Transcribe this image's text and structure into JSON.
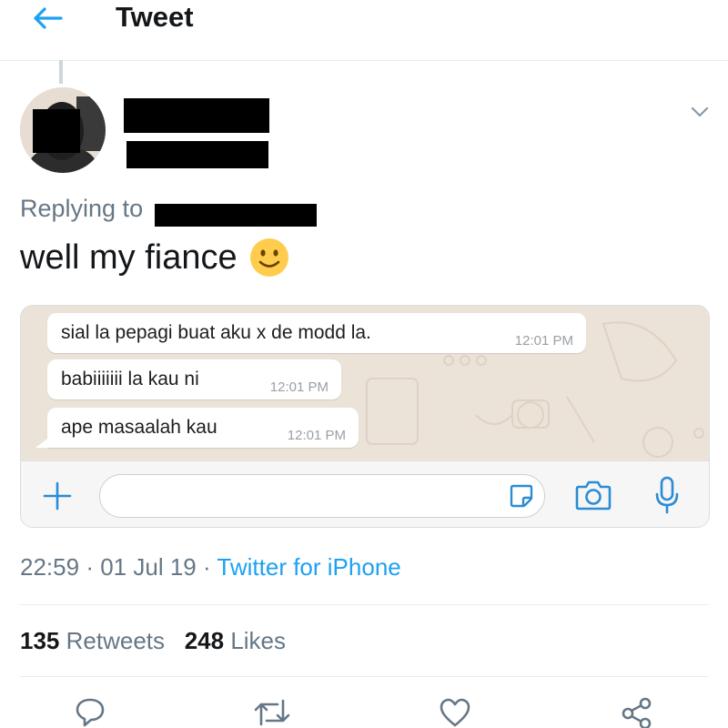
{
  "header": {
    "title": "Tweet",
    "back_icon": "back-arrow-icon"
  },
  "tweet": {
    "replying_label": "Replying to",
    "text": "well my fiance",
    "emoji": "🙂"
  },
  "whatsapp": {
    "messages": [
      {
        "text": "sial la pepagi buat aku x de modd la.",
        "time": "12:01 PM"
      },
      {
        "text": "babiiiiiii la kau ni",
        "time": "12:01 PM"
      },
      {
        "text": "ape masaalah kau",
        "time": "12:01 PM"
      }
    ],
    "input_placeholder": ""
  },
  "meta": {
    "time": "22:59",
    "date": "01 Jul 19",
    "separator": "·",
    "source": "Twitter for iPhone"
  },
  "stats": {
    "retweets_count": "135",
    "retweets_label": "Retweets",
    "likes_count": "248",
    "likes_label": "Likes"
  },
  "colors": {
    "accent": "#1da1f2",
    "secondary_text": "#657786",
    "whatsapp_blue": "#2a8cd4",
    "chat_bg": "#ece3d8"
  }
}
